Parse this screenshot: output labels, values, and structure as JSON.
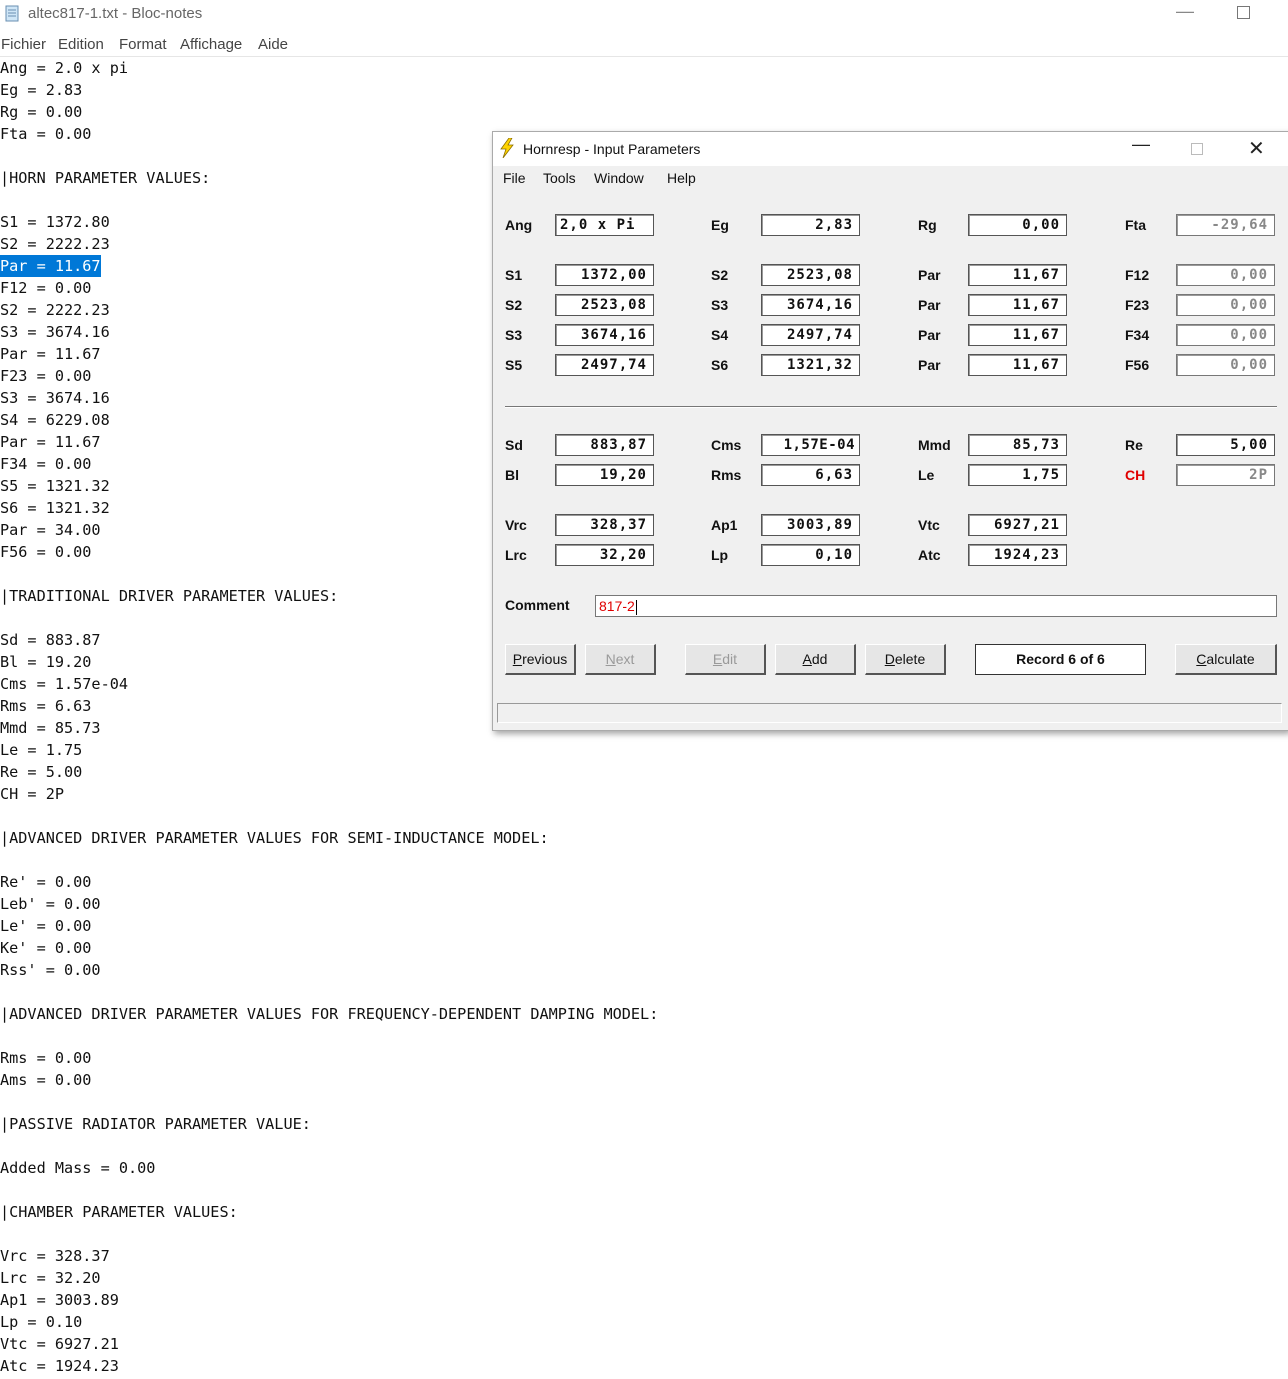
{
  "notepad": {
    "title": "altec817-1.txt - Bloc-notes",
    "menu": [
      "Fichier",
      "Edition",
      "Format",
      "Affichage",
      "Aide"
    ],
    "lines": [
      "Ang = 2.0 x pi",
      "Eg = 2.83",
      "Rg = 0.00",
      "Fta = 0.00",
      "",
      "|HORN PARAMETER VALUES:",
      "",
      "S1 = 1372.80",
      "S2 = 2222.23",
      "Par = 11.67",
      "F12 = 0.00",
      "S2 = 2222.23",
      "S3 = 3674.16",
      "Par = 11.67",
      "F23 = 0.00",
      "S3 = 3674.16",
      "S4 = 6229.08",
      "Par = 11.67",
      "F34 = 0.00",
      "S5 = 1321.32",
      "S6 = 1321.32",
      "Par = 34.00",
      "F56 = 0.00",
      "",
      "|TRADITIONAL DRIVER PARAMETER VALUES:",
      "",
      "Sd = 883.87",
      "Bl = 19.20",
      "Cms = 1.57e-04",
      "Rms = 6.63",
      "Mmd = 85.73",
      "Le = 1.75",
      "Re = 5.00",
      "CH = 2P",
      "",
      "|ADVANCED DRIVER PARAMETER VALUES FOR SEMI-INDUCTANCE MODEL:",
      "",
      "Re' = 0.00",
      "Leb' = 0.00",
      "Le' = 0.00",
      "Ke' = 0.00",
      "Rss' = 0.00",
      "",
      "|ADVANCED DRIVER PARAMETER VALUES FOR FREQUENCY-DEPENDENT DAMPING MODEL:",
      "",
      "Rms = 0.00",
      "Ams = 0.00",
      "",
      "|PASSIVE RADIATOR PARAMETER VALUE:",
      "",
      "Added Mass = 0.00",
      "",
      "|CHAMBER PARAMETER VALUES:",
      "",
      "Vrc = 328.37",
      "Lrc = 32.20",
      "Ap1 = 3003.89",
      "Lp = 0.10",
      "Vtc = 6927.21",
      "Atc = 1924.23"
    ],
    "selected_line": "Par = 11.67"
  },
  "hornresp": {
    "title": "Hornresp - Input Parameters",
    "menu": [
      "File",
      "Tools",
      "Window",
      "Help"
    ],
    "labels": {
      "Ang": "Ang",
      "Eg": "Eg",
      "Rg": "Rg",
      "Fta": "Fta",
      "S1": "S1",
      "S2": "S2",
      "S3": "S3",
      "S4": "S4",
      "S5": "S5",
      "S6": "S6",
      "Par": "Par",
      "F12": "F12",
      "F23": "F23",
      "F34": "F34",
      "F56": "F56",
      "Sd": "Sd",
      "Cms": "Cms",
      "Mmd": "Mmd",
      "Re": "Re",
      "Bl": "Bl",
      "Rms": "Rms",
      "Le": "Le",
      "CH": "CH",
      "Vrc": "Vrc",
      "Ap1": "Ap1",
      "Vtc": "Vtc",
      "Lrc": "Lrc",
      "Lp": "Lp",
      "Atc": "Atc",
      "Comment": "Comment"
    },
    "values": {
      "Ang": "2,0 x Pi",
      "Eg": "2,83",
      "Rg": "0,00",
      "Fta": "-29,64",
      "r1_S1": "1372,00",
      "r1_S2": "2523,08",
      "r1_Par": "11,67",
      "F12": "0,00",
      "r2_S2": "2523,08",
      "r2_S3": "3674,16",
      "r2_Par": "11,67",
      "F23": "0,00",
      "r3_S3": "3674,16",
      "r3_S4": "2497,74",
      "r3_Par": "11,67",
      "F34": "0,00",
      "r4_S5": "2497,74",
      "r4_S6": "1321,32",
      "r4_Par": "11,67",
      "F56": "0,00",
      "Sd": "883,87",
      "Cms": "1,57E-04",
      "Mmd": "85,73",
      "Re": "5,00",
      "Bl": "19,20",
      "Rms": "6,63",
      "Le": "1,75",
      "CH": "2P",
      "Vrc": "328,37",
      "Ap1": "3003,89",
      "Vtc": "6927,21",
      "Lrc": "32,20",
      "Lp": "0,10",
      "Atc": "1924,23",
      "Comment": "817-2"
    },
    "buttons": {
      "previous": [
        "P",
        "revious"
      ],
      "next": [
        "N",
        "ext"
      ],
      "edit": [
        "E",
        "dit"
      ],
      "add": [
        "A",
        "dd"
      ],
      "delete": [
        "D",
        "elete"
      ],
      "calculate": [
        "C",
        "alculate"
      ]
    },
    "record": "Record 6 of 6",
    "colors": {
      "highlight": "#e00000",
      "selection": "#0078d7"
    }
  }
}
